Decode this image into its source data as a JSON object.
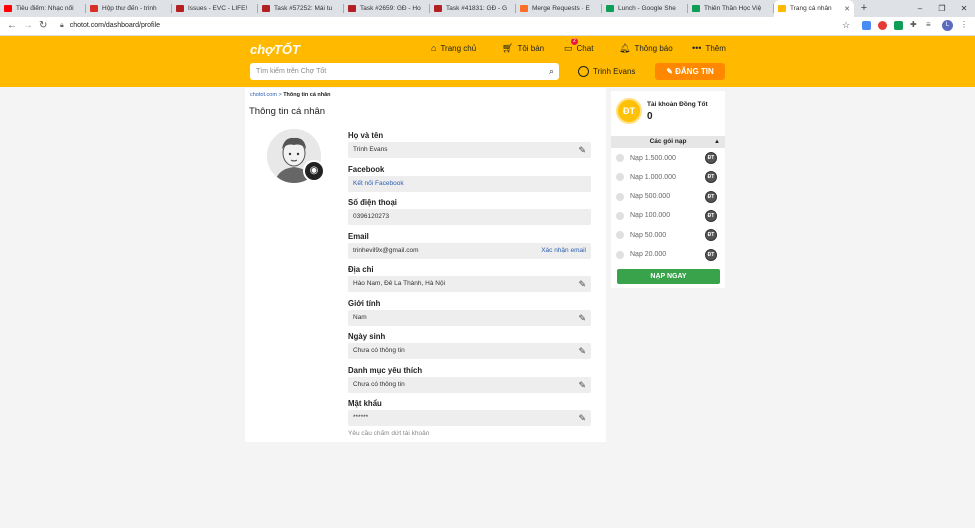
{
  "browser": {
    "tabs": [
      {
        "title": "Tiêu điểm: Nhạc nổi",
        "favicon": "youtube-icon",
        "color": "#ff0000"
      },
      {
        "title": "Hộp thư đến - trinh",
        "favicon": "gmail-icon",
        "color": "#d93025"
      },
      {
        "title": "Issues - EVC - LIFE!",
        "favicon": "redmine-icon",
        "color": "#b32024"
      },
      {
        "title": "Task #57252: Mái tu",
        "favicon": "redmine-icon",
        "color": "#b32024"
      },
      {
        "title": "Task #2659: GĐ - Ho",
        "favicon": "redmine-icon",
        "color": "#b32024"
      },
      {
        "title": "Task #41831: GĐ - G",
        "favicon": "redmine-icon",
        "color": "#b32024"
      },
      {
        "title": "Merge Requests · E",
        "favicon": "gitlab-icon",
        "color": "#fc6d26"
      },
      {
        "title": "Lunch - Google She",
        "favicon": "sheets-icon",
        "color": "#0f9d58"
      },
      {
        "title": "Thiên Thần Học Việ",
        "favicon": "sheets-icon",
        "color": "#0f9d58"
      },
      {
        "title": "Trang cá nhân",
        "favicon": "chotot-icon",
        "color": "#ffba00",
        "active": true
      }
    ],
    "url": "chotot.com/dashboard/profile",
    "profile_initial": "L"
  },
  "header": {
    "logo": "chợTỐT",
    "nav": [
      {
        "label": "Trang chủ",
        "icon": "home-icon"
      },
      {
        "label": "Tôi bán",
        "icon": "basket-icon"
      },
      {
        "label": "Chat",
        "icon": "chat-icon",
        "badge": "2"
      },
      {
        "label": "Thông báo",
        "icon": "bell-icon"
      },
      {
        "label": "Thêm",
        "icon": "more-icon"
      }
    ],
    "search_placeholder": "Tìm kiếm trên Chợ Tốt",
    "user_name": "Trinh Evans",
    "post_label": "ĐĂNG TIN"
  },
  "profile": {
    "breadcrumb_home": "chotot.com",
    "breadcrumb_sep": ">",
    "breadcrumb_current": "Thông tin cá nhân",
    "title": "Thông tin cá nhân",
    "fields": [
      {
        "label": "Họ và tên",
        "value": "Trinh Evans",
        "editable": true
      },
      {
        "label": "Facebook",
        "value": "Kết nối Facebook",
        "link": true
      },
      {
        "label": "Số điện thoại",
        "value": "0396120273"
      },
      {
        "label": "Email",
        "value": "trinhevil9x@gmail.com",
        "action": "Xác nhận email"
      },
      {
        "label": "Địa chỉ",
        "value": "Hào Nam, Đê La Thành, Hà Nội",
        "editable": true
      },
      {
        "label": "Giới tính",
        "value": "Nam",
        "editable": true
      },
      {
        "label": "Ngày sinh",
        "value": "Chưa có thông tin",
        "editable": true
      },
      {
        "label": "Danh mục yêu thích",
        "value": "Chưa có thông tin",
        "editable": true
      },
      {
        "label": "Mật khẩu",
        "value": "******",
        "editable": true
      }
    ],
    "delete_account": "Yêu cầu chấm dứt tài khoản"
  },
  "wallet": {
    "coin": "ĐT",
    "account_label": "Tài khoản Đồng Tốt",
    "balance": "0",
    "packages_header": "Các gói nạp",
    "packages": [
      "Nạp 1.500.000",
      "Nạp 1.000.000",
      "Nạp 500.000",
      "Nạp 100.000",
      "Nạp 50.000",
      "Nạp 20.000"
    ],
    "buy_label": "NẠP NGAY"
  }
}
